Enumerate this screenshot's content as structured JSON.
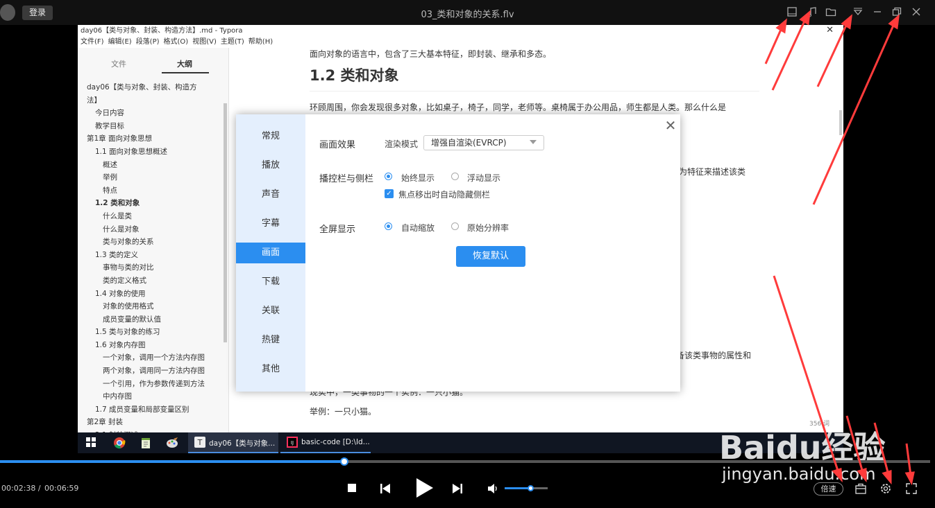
{
  "player": {
    "login": "登录",
    "video_title": "03_类和对象的关系.flv",
    "time_current": "00:02:38 /",
    "time_total": "00:06:59",
    "speed": "倍速",
    "progress_fraction": 0.37,
    "volume_fraction": 0.6
  },
  "typora": {
    "title": "day06【类与对象、封装、构造方法】.md - Typora",
    "menu": [
      "文件(F)",
      "编辑(E)",
      "段落(P)",
      "格式(O)",
      "视图(V)",
      "主题(T)",
      "帮助(H)"
    ],
    "tab_file": "文件",
    "tab_outline": "大纲",
    "outline": [
      {
        "level": 1,
        "text": "day06【类与对象、封装、构造方",
        "bold": false
      },
      {
        "level": 1,
        "text": "法】",
        "bold": false
      },
      {
        "level": 2,
        "text": "今日内容",
        "bold": false
      },
      {
        "level": 2,
        "text": "教学目标",
        "bold": false
      },
      {
        "level": 1,
        "text": "第1章 面向对象思想",
        "bold": false
      },
      {
        "level": 2,
        "text": "1.1 面向对象思想概述",
        "bold": false
      },
      {
        "level": 3,
        "text": "概述",
        "bold": false
      },
      {
        "level": 3,
        "text": "举例",
        "bold": false
      },
      {
        "level": 3,
        "text": "特点",
        "bold": false
      },
      {
        "level": 2,
        "text": "1.2 类和对象",
        "bold": true
      },
      {
        "level": 3,
        "text": "什么是类",
        "bold": false
      },
      {
        "level": 3,
        "text": "什么是对象",
        "bold": false
      },
      {
        "level": 3,
        "text": "类与对象的关系",
        "bold": false
      },
      {
        "level": 2,
        "text": "1.3 类的定义",
        "bold": false
      },
      {
        "level": 3,
        "text": "事物与类的对比",
        "bold": false
      },
      {
        "level": 3,
        "text": "类的定义格式",
        "bold": false
      },
      {
        "level": 2,
        "text": "1.4 对象的使用",
        "bold": false
      },
      {
        "level": 3,
        "text": "对象的使用格式",
        "bold": false
      },
      {
        "level": 3,
        "text": "成员变量的默认值",
        "bold": false
      },
      {
        "level": 2,
        "text": "1.5 类与对象的练习",
        "bold": false
      },
      {
        "level": 2,
        "text": "1.6 对象内存图",
        "bold": false
      },
      {
        "level": 3,
        "text": "一个对象，调用一个方法内存图",
        "bold": false
      },
      {
        "level": 3,
        "text": "两个对象，调用同一方法内存图",
        "bold": false
      },
      {
        "level": 3,
        "text": "一个引用，作为参数传递到方法",
        "bold": false
      },
      {
        "level": 3,
        "text": "中内存图",
        "bold": false
      },
      {
        "level": 2,
        "text": "1.7 成员变量和局部变量区别",
        "bold": false
      },
      {
        "level": 1,
        "text": "第2章 封装",
        "bold": false
      },
      {
        "level": 2,
        "text": "2.1 封装概述",
        "bold": false
      }
    ],
    "side_footer": "‹  ‹/›",
    "para1": "面向对象的语言中，包含了三大基本特征，即封装、继承和多态。",
    "heading": "1.2 类和对象",
    "para2": "环顾周围，你会发现很多对象，比如桌子，椅子，同学，老师等。桌椅属于办公用品，师生都是人类。那么什么是",
    "frag1": "行为特征来描述该类",
    "frag2": "备该类事物的属性和",
    "frag3": "现实中，一类事物的一个实例：一只小猫。",
    "para_cat": "举例：一只小猫。",
    "word_count": "356 词"
  },
  "settings": {
    "nav": [
      "常规",
      "播放",
      "声音",
      "字幕",
      "画面",
      "下载",
      "关联",
      "热键",
      "其他"
    ],
    "active_nav": "画面",
    "label_effect": "画面效果",
    "label_render_mode": "渲染模式",
    "render_mode_value": "增强自渲染(EVRCP)",
    "label_controls": "播控栏与侧栏",
    "opt_always": "始终显示",
    "opt_float": "浮动显示",
    "opt_autohide": "焦点移出时自动隐藏侧栏",
    "label_fullscreen": "全屏显示",
    "opt_autoscale": "自动缩放",
    "opt_original": "原始分辨率",
    "restore_button": "恢复默认"
  },
  "taskbar": {
    "typora_task": "day06【类与对象...",
    "idea_task": "basic-code [D:\\Id..."
  },
  "watermark": {
    "text": "Baidu经验",
    "url": "jingyan.baidu.com"
  },
  "colors": {
    "accent": "#2b8ef0",
    "arrow": "#ff3b3b"
  }
}
